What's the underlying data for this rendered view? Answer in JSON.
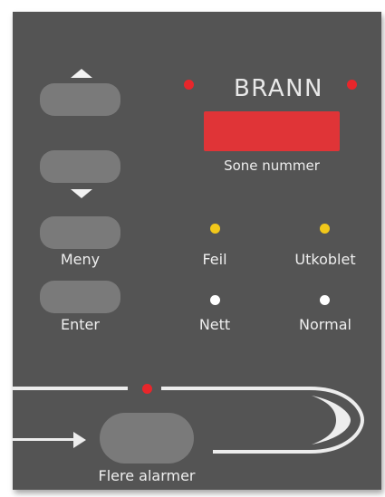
{
  "panel": {
    "title": "BRANN",
    "zone_label": "Sone nummer",
    "colors": {
      "panel_bg": "#545454",
      "button": "#7a7a7a",
      "fire_led": "#e8262b",
      "fault_led": "#f2c81a",
      "power_led": "#ffffff",
      "display": "#e03437",
      "text": "#eeeeee"
    }
  },
  "buttons": {
    "up": {
      "icon": "arrow-up-icon"
    },
    "down": {
      "icon": "arrow-down-icon"
    },
    "menu": {
      "label": "Meny"
    },
    "enter": {
      "label": "Enter"
    },
    "more_alarms": {
      "label": "Flere alarmer"
    }
  },
  "indicators": {
    "fault": {
      "label": "Feil",
      "color": "yellow"
    },
    "disabled": {
      "label": "Utkoblet",
      "color": "yellow"
    },
    "power": {
      "label": "Nett",
      "color": "white"
    },
    "normal": {
      "label": "Normal",
      "color": "white"
    }
  }
}
